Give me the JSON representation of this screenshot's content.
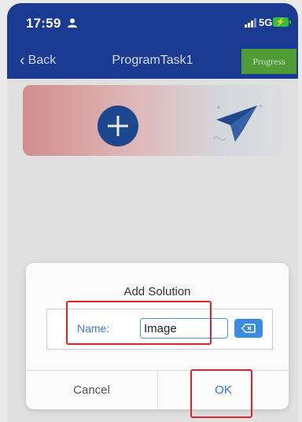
{
  "status_bar": {
    "time": "17:59",
    "network": "5G",
    "icons": [
      "person-icon",
      "signal-bars-icon",
      "battery-charging-icon"
    ]
  },
  "nav": {
    "back_label": "Back",
    "title": "ProgramTask1",
    "progress_label": "Progress",
    "back_icon": "chevron-left-icon"
  },
  "banner": {
    "icons": [
      "add-circle-icon",
      "paper-plane-icon"
    ]
  },
  "dialog": {
    "title": "Add Solution",
    "name_label": "Name:",
    "name_value": "Image",
    "clear_icon": "backspace-icon",
    "cancel_label": "Cancel",
    "ok_label": "OK"
  },
  "colors": {
    "header": "#1b3a92",
    "progress_button": "#4f9c37",
    "accent_blue": "#2f76e0",
    "annotation_red": "#e1222a"
  }
}
